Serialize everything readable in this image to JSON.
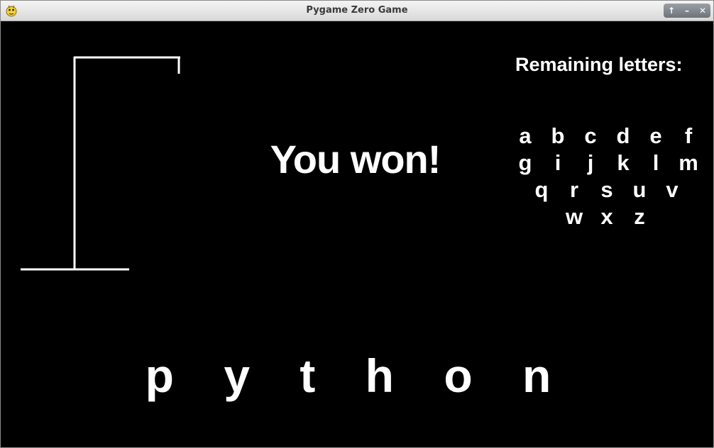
{
  "window": {
    "title": "Pygame Zero Game",
    "controls": {
      "up": "↑",
      "minimize": "–",
      "close": "✕"
    }
  },
  "game": {
    "remaining_title": "Remaining letters:",
    "remaining_rows": [
      [
        "a",
        "b",
        "c",
        "d",
        "e",
        "f"
      ],
      [
        "g",
        "i",
        "j",
        "k",
        "l",
        "m"
      ],
      [
        "q",
        "r",
        "s",
        "u",
        "v"
      ],
      [
        "w",
        "x",
        "z"
      ]
    ],
    "status": "You won!",
    "word": "p y t h o n"
  },
  "colors": {
    "background": "#000000",
    "foreground": "#ffffff"
  }
}
